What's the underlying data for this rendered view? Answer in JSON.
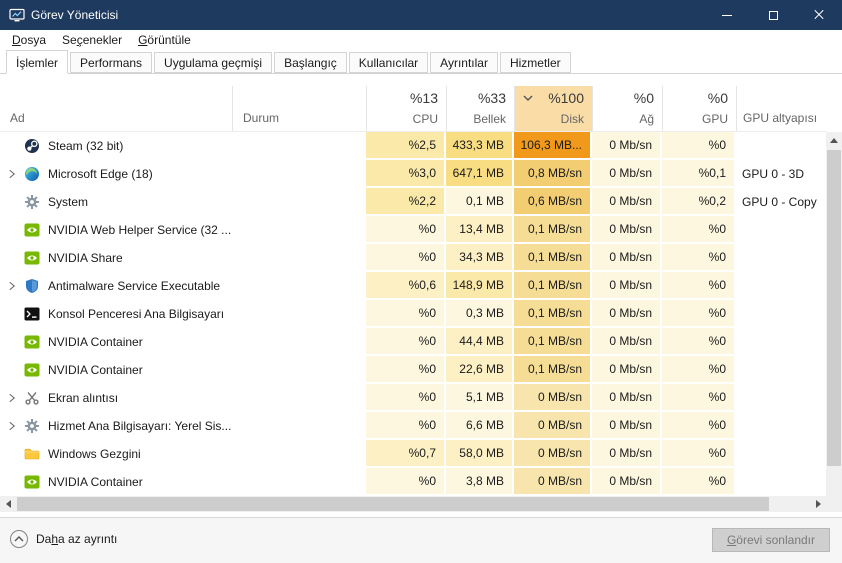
{
  "window": {
    "title": "Görev Yöneticisi"
  },
  "menu": {
    "items": [
      {
        "pre": "",
        "accel": "D",
        "rest": "osya"
      },
      {
        "pre": "Se",
        "accel": "ç",
        "rest": "enekler"
      },
      {
        "pre": "",
        "accel": "G",
        "rest": "örüntüle"
      }
    ]
  },
  "tabs": [
    {
      "label": "İşlemler",
      "active": true
    },
    {
      "label": "Performans",
      "active": false
    },
    {
      "label": "Uygulama geçmişi",
      "active": false
    },
    {
      "label": "Başlangıç",
      "active": false
    },
    {
      "label": "Kullanıcılar",
      "active": false
    },
    {
      "label": "Ayrıntılar",
      "active": false
    },
    {
      "label": "Hizmetler",
      "active": false
    }
  ],
  "header": {
    "name": "Ad",
    "status": "Durum",
    "cpu": {
      "value": "%13",
      "label": "CPU"
    },
    "memory": {
      "value": "%33",
      "label": "Bellek"
    },
    "disk": {
      "value": "%100",
      "label": "Disk",
      "sorted": "desc"
    },
    "network": {
      "value": "%0",
      "label": "Ağ"
    },
    "gpu": {
      "value": "%0",
      "label": "GPU"
    },
    "gpu_engine": {
      "label": "GPU altyapısı"
    }
  },
  "processes": [
    {
      "name": "Steam (32 bit)",
      "status": "",
      "cpu": "%2,5",
      "memory": "433,3 MB",
      "disk": "106,3 MB...",
      "network": "0 Mb/sn",
      "gpu": "%0",
      "gpu_engine": "",
      "icon": "steam-icon",
      "expandable": false
    },
    {
      "name": "Microsoft Edge (18)",
      "status": "",
      "cpu": "%3,0",
      "memory": "647,1 MB",
      "disk": "0,8 MB/sn",
      "network": "0 Mb/sn",
      "gpu": "%0,1",
      "gpu_engine": "GPU 0 - 3D",
      "icon": "edge-icon",
      "expandable": true
    },
    {
      "name": "System",
      "status": "",
      "cpu": "%2,2",
      "memory": "0,1 MB",
      "disk": "0,6 MB/sn",
      "network": "0 Mb/sn",
      "gpu": "%0,2",
      "gpu_engine": "GPU 0 - Copy",
      "icon": "system-gear-icon",
      "expandable": false
    },
    {
      "name": "NVIDIA Web Helper Service (32 ...",
      "status": "",
      "cpu": "%0",
      "memory": "13,4 MB",
      "disk": "0,1 MB/sn",
      "network": "0 Mb/sn",
      "gpu": "%0",
      "gpu_engine": "",
      "icon": "nvidia-icon",
      "expandable": false
    },
    {
      "name": "NVIDIA Share",
      "status": "",
      "cpu": "%0",
      "memory": "34,3 MB",
      "disk": "0,1 MB/sn",
      "network": "0 Mb/sn",
      "gpu": "%0",
      "gpu_engine": "",
      "icon": "nvidia-icon",
      "expandable": false
    },
    {
      "name": "Antimalware Service Executable",
      "status": "",
      "cpu": "%0,6",
      "memory": "148,9 MB",
      "disk": "0,1 MB/sn",
      "network": "0 Mb/sn",
      "gpu": "%0",
      "gpu_engine": "",
      "icon": "antimalware-shield-icon",
      "expandable": true
    },
    {
      "name": "Konsol Penceresi Ana Bilgisayarı",
      "status": "",
      "cpu": "%0",
      "memory": "0,3 MB",
      "disk": "0,1 MB/sn",
      "network": "0 Mb/sn",
      "gpu": "%0",
      "gpu_engine": "",
      "icon": "console-icon",
      "expandable": false
    },
    {
      "name": "NVIDIA Container",
      "status": "",
      "cpu": "%0",
      "memory": "44,4 MB",
      "disk": "0,1 MB/sn",
      "network": "0 Mb/sn",
      "gpu": "%0",
      "gpu_engine": "",
      "icon": "nvidia-icon",
      "expandable": false
    },
    {
      "name": "NVIDIA Container",
      "status": "",
      "cpu": "%0",
      "memory": "22,6 MB",
      "disk": "0,1 MB/sn",
      "network": "0 Mb/sn",
      "gpu": "%0",
      "gpu_engine": "",
      "icon": "nvidia-icon",
      "expandable": false
    },
    {
      "name": "Ekran alıntısı",
      "status": "",
      "cpu": "%0",
      "memory": "5,1 MB",
      "disk": "0 MB/sn",
      "network": "0 Mb/sn",
      "gpu": "%0",
      "gpu_engine": "",
      "icon": "scissors-icon",
      "expandable": true
    },
    {
      "name": "Hizmet Ana Bilgisayarı: Yerel Sis...",
      "status": "",
      "cpu": "%0",
      "memory": "6,6 MB",
      "disk": "0 MB/sn",
      "network": "0 Mb/sn",
      "gpu": "%0",
      "gpu_engine": "",
      "icon": "service-gear-icon",
      "expandable": true
    },
    {
      "name": "Windows Gezgini",
      "status": "",
      "cpu": "%0,7",
      "memory": "58,0 MB",
      "disk": "0 MB/sn",
      "network": "0 Mb/sn",
      "gpu": "%0",
      "gpu_engine": "",
      "icon": "folder-icon",
      "expandable": false
    },
    {
      "name": "NVIDIA Container",
      "status": "",
      "cpu": "%0",
      "memory": "3,8 MB",
      "disk": "0 MB/sn",
      "network": "0 Mb/sn",
      "gpu": "%0",
      "gpu_engine": "",
      "icon": "nvidia-icon",
      "expandable": false
    }
  ],
  "footer": {
    "details_toggle": {
      "pre": "Da",
      "accel": "h",
      "rest": "a az ayrıntı"
    },
    "end_task": {
      "pre": "",
      "accel": "G",
      "rest": "örevi sonlandır",
      "enabled": false
    }
  },
  "colors": {
    "title_bar_bg": "#1f3a5f",
    "heat_low": "#fdf7df",
    "heat_mid": "#fbe9a9",
    "heat_high": "#f9dd82",
    "disk_col_low": "#f7e5ad",
    "disk_col_mid": "#f2cd72",
    "disk_col_max": "#f0991a",
    "disk_header_bg": "#f9dca6",
    "nvidia_green": "#76b900",
    "folder_yellow": "#ffc83d",
    "disabled_button_bg": "#cfcfcf"
  }
}
